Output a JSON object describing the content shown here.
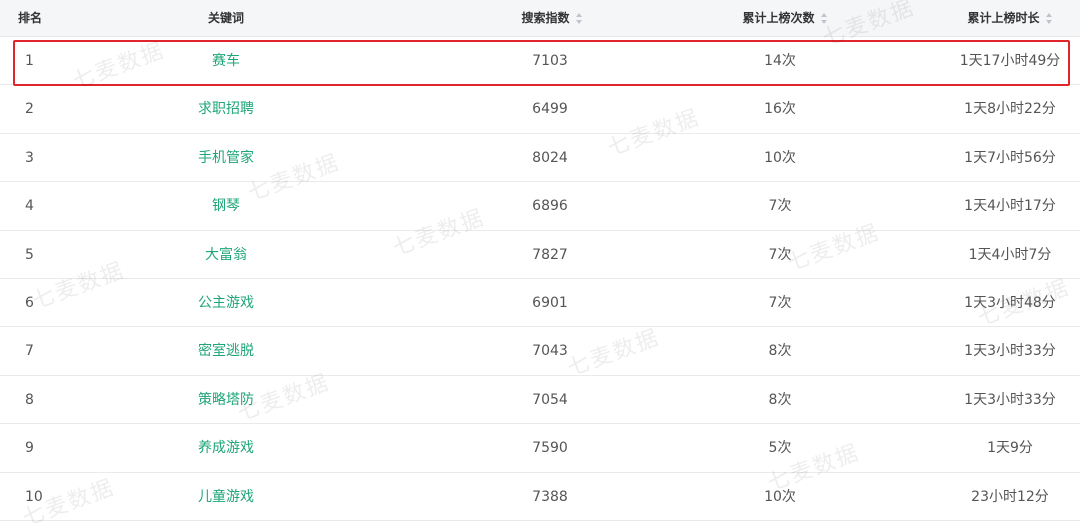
{
  "table": {
    "headers": {
      "rank": "排名",
      "keyword": "关键词",
      "search_index": "搜索指数",
      "count": "累计上榜次数",
      "duration": "累计上榜时长"
    },
    "rows": [
      {
        "rank": "1",
        "keyword": "赛车",
        "search_index": "7103",
        "count": "14次",
        "duration": "1天17小时49分"
      },
      {
        "rank": "2",
        "keyword": "求职招聘",
        "search_index": "6499",
        "count": "16次",
        "duration": "1天8小时22分"
      },
      {
        "rank": "3",
        "keyword": "手机管家",
        "search_index": "8024",
        "count": "10次",
        "duration": "1天7小时56分"
      },
      {
        "rank": "4",
        "keyword": "钢琴",
        "search_index": "6896",
        "count": "7次",
        "duration": "1天4小时17分"
      },
      {
        "rank": "5",
        "keyword": "大富翁",
        "search_index": "7827",
        "count": "7次",
        "duration": "1天4小时7分"
      },
      {
        "rank": "6",
        "keyword": "公主游戏",
        "search_index": "6901",
        "count": "7次",
        "duration": "1天3小时48分"
      },
      {
        "rank": "7",
        "keyword": "密室逃脱",
        "search_index": "7043",
        "count": "8次",
        "duration": "1天3小时33分"
      },
      {
        "rank": "8",
        "keyword": "策略塔防",
        "search_index": "7054",
        "count": "8次",
        "duration": "1天3小时33分"
      },
      {
        "rank": "9",
        "keyword": "养成游戏",
        "search_index": "7590",
        "count": "5次",
        "duration": "1天9分"
      },
      {
        "rank": "10",
        "keyword": "儿童游戏",
        "search_index": "7388",
        "count": "10次",
        "duration": "23小时12分"
      }
    ]
  },
  "watermark_text": "七麦数据",
  "colors": {
    "keyword_green": "#1fa678",
    "highlight_red": "#e0262a",
    "header_bg": "#f5f6f8"
  }
}
